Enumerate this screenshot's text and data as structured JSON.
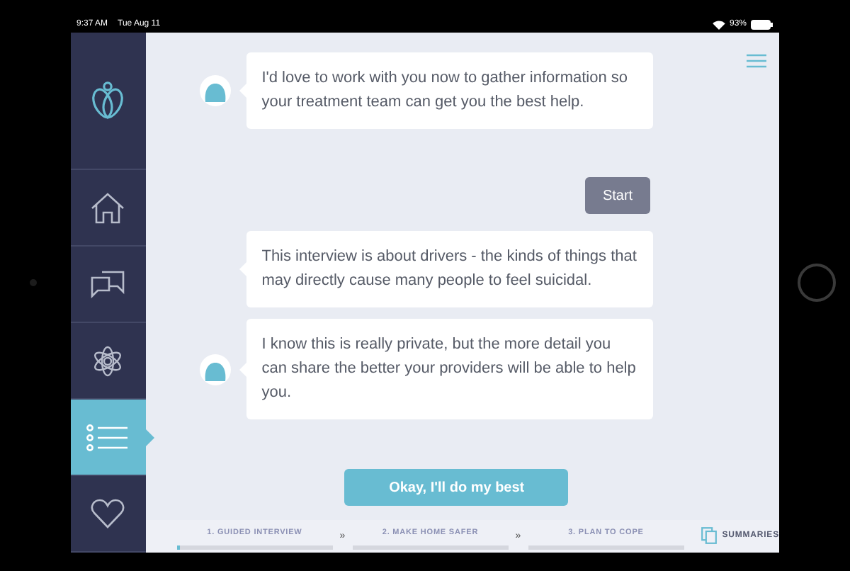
{
  "status_bar": {
    "time": "9:37 AM",
    "date": "Tue Aug 11",
    "battery": "93%"
  },
  "sidebar": {
    "items": [
      {
        "selected": false
      },
      {
        "selected": false
      },
      {
        "selected": false
      },
      {
        "selected": true
      },
      {
        "selected": false
      }
    ]
  },
  "messages": [
    {
      "kind": "bot",
      "avatar": true,
      "text": "I'd love to work with you now to gather information so your treatment team can get you the best help."
    },
    {
      "kind": "reply",
      "text": "Start"
    },
    {
      "kind": "bot",
      "avatar": false,
      "text": "This interview is about drivers - the kinds of things that may directly cause many people to feel suicidal."
    },
    {
      "kind": "bot",
      "avatar": true,
      "text": "I know this is really private, but the more detail you can share the better your providers will be able to help you."
    }
  ],
  "action_button": "Okay, I'll do my best",
  "steps": [
    {
      "label": "1. GUIDED INTERVIEW",
      "level": 0.02
    },
    {
      "label": "2. MAKE HOME SAFER",
      "level": 0
    },
    {
      "label": "3. PLAN TO COPE",
      "level": 0
    }
  ],
  "separator": "»",
  "summaries": "SUMMARIES"
}
